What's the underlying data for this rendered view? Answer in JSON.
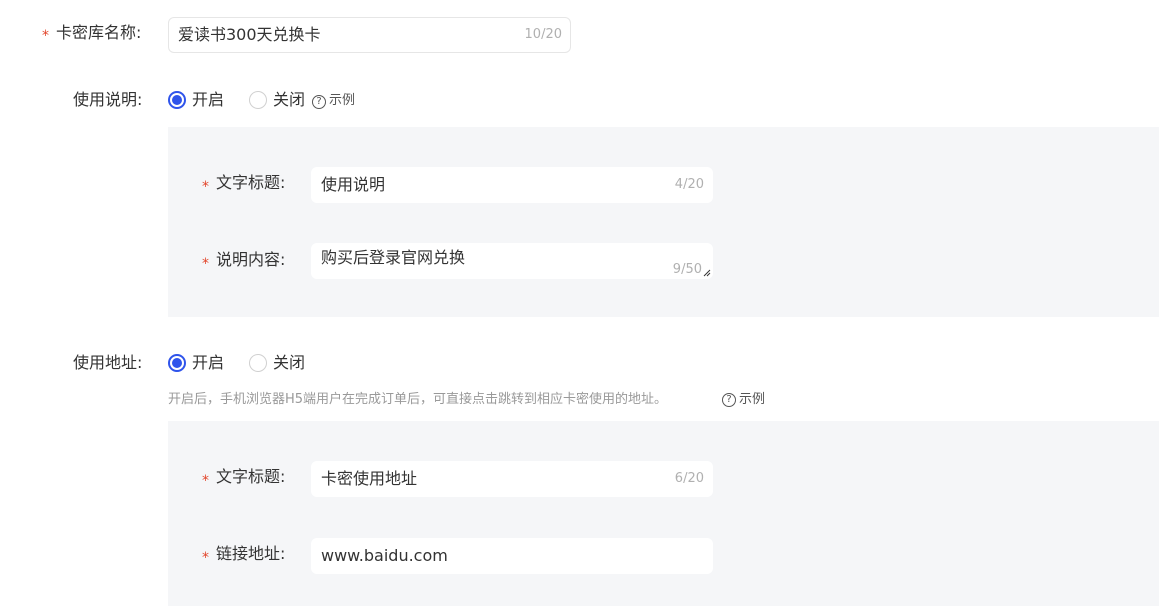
{
  "fields": {
    "name": {
      "label": "卡密库名称:",
      "value": "爱读书300天兑换卡",
      "count": "10/20"
    },
    "usage_desc": {
      "label": "使用说明:",
      "on_label": "开启",
      "off_label": "关闭",
      "example": "示例",
      "selected": "on",
      "title": {
        "label": "文字标题:",
        "value": "使用说明",
        "count": "4/20"
      },
      "content": {
        "label": "说明内容:",
        "value": "购买后登录官网兑换",
        "count": "9/50"
      }
    },
    "usage_addr": {
      "label": "使用地址:",
      "on_label": "开启",
      "off_label": "关闭",
      "selected": "on",
      "hint": "开启后，手机浏览器H5端用户在完成订单后，可直接点击跳转到相应卡密使用的地址。",
      "example": "示例",
      "title": {
        "label": "文字标题:",
        "value": "卡密使用地址",
        "count": "6/20"
      },
      "link": {
        "label": "链接地址:",
        "value": "www.baidu.com"
      }
    }
  },
  "colors": {
    "accent": "#2f54eb",
    "required": "#e2452a",
    "panel_bg": "#f5f6f8"
  }
}
